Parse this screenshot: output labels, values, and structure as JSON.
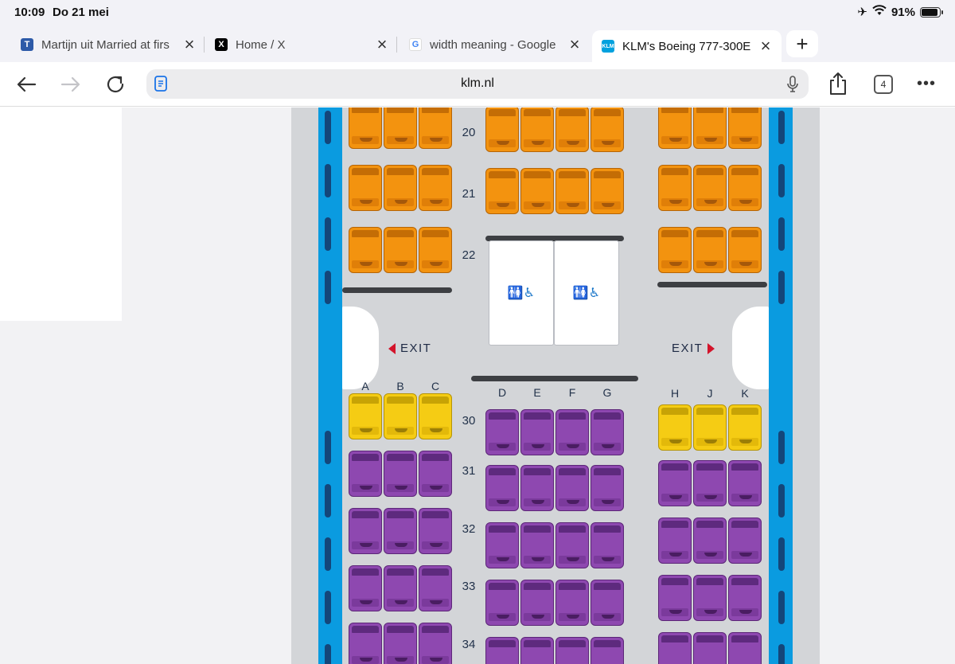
{
  "status_bar": {
    "time": "10:09",
    "date": "Do 21 mei",
    "battery": "91%",
    "battery_level": 0.91
  },
  "tabs": [
    {
      "title": "Martijn uit Married at firs",
      "favicon": "telegraaf-icon",
      "active": false
    },
    {
      "title": "Home / X",
      "favicon": "x-icon",
      "active": false
    },
    {
      "title": "width meaning - Google",
      "favicon": "google-icon",
      "active": false
    },
    {
      "title": "KLM's Boeing 777-300E",
      "favicon": "klm-icon",
      "active": true
    }
  ],
  "toolbar": {
    "url": "klm.nl",
    "tab_count": "4"
  },
  "seatmap": {
    "colors": {
      "extra_comfort": "#f3930f",
      "selected": "#f5cc14",
      "economy": "#8e48b0",
      "wall": "#0a9be0"
    },
    "exit_label": "EXIT",
    "left_columns": [
      "A",
      "B",
      "C"
    ],
    "middle_columns": [
      "D",
      "E",
      "F",
      "G"
    ],
    "right_columns": [
      "H",
      "J",
      "K"
    ],
    "rows_front": [
      "20",
      "21",
      "22"
    ],
    "rows_back": [
      "30",
      "31",
      "32",
      "33",
      "34"
    ]
  }
}
